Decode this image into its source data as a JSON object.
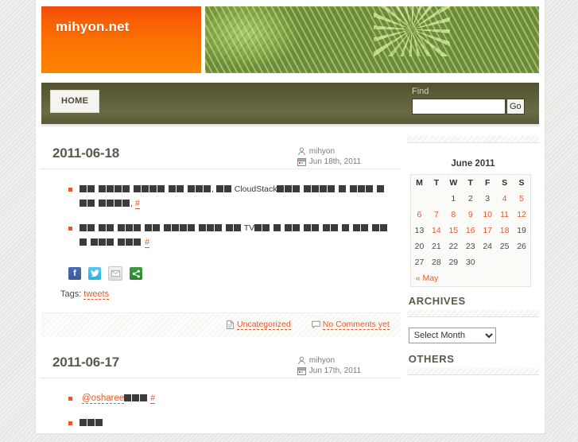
{
  "site": {
    "logo_title": "mihyon.net"
  },
  "nav": {
    "home_label": "HOME",
    "find_label": "Find",
    "find_value": "",
    "find_placeholder": "",
    "go_label": "Go"
  },
  "posts": [
    {
      "title": "2011-06-18",
      "author": "mihyon",
      "date": "Jun 18th, 2011",
      "lines": [
        {
          "runs": [
            {
              "t": "blocks",
              "n": 2
            },
            {
              "t": "sp"
            },
            {
              "t": "blocks",
              "n": 4
            },
            {
              "t": "sp"
            },
            {
              "t": "blocks",
              "n": 4
            },
            {
              "t": "sp"
            },
            {
              "t": "blocks",
              "n": 2
            },
            {
              "t": "sp"
            },
            {
              "t": "blocks",
              "n": 3
            },
            {
              "t": "text",
              "v": ", "
            },
            {
              "t": "blocks",
              "n": 2
            },
            {
              "t": "text",
              "v": " CloudStack"
            },
            {
              "t": "blocks",
              "n": 3
            },
            {
              "t": "sp"
            },
            {
              "t": "blocks",
              "n": 4
            },
            {
              "t": "sp"
            },
            {
              "t": "blocks",
              "n": 1
            },
            {
              "t": "sp"
            },
            {
              "t": "blocks",
              "n": 3
            },
            {
              "t": "sp"
            },
            {
              "t": "blocks",
              "n": 3
            },
            {
              "t": "sp"
            },
            {
              "t": "blocks",
              "n": 4
            },
            {
              "t": "text",
              "v": ", "
            },
            {
              "t": "hash",
              "v": "#"
            }
          ]
        },
        {
          "runs": [
            {
              "t": "blocks",
              "n": 2
            },
            {
              "t": "sp"
            },
            {
              "t": "blocks",
              "n": 2
            },
            {
              "t": "sp"
            },
            {
              "t": "blocks",
              "n": 3
            },
            {
              "t": "sp"
            },
            {
              "t": "blocks",
              "n": 2
            },
            {
              "t": "sp"
            },
            {
              "t": "blocks",
              "n": 4
            },
            {
              "t": "sp"
            },
            {
              "t": "blocks",
              "n": 3
            },
            {
              "t": "sp"
            },
            {
              "t": "blocks",
              "n": 2
            },
            {
              "t": "text",
              "v": " TV"
            },
            {
              "t": "blocks",
              "n": 2
            },
            {
              "t": "sp"
            },
            {
              "t": "blocks",
              "n": 1
            },
            {
              "t": "sp"
            },
            {
              "t": "blocks",
              "n": 2
            },
            {
              "t": "sp"
            },
            {
              "t": "blocks",
              "n": 2
            },
            {
              "t": "sp"
            },
            {
              "t": "blocks",
              "n": 2
            },
            {
              "t": "sp"
            },
            {
              "t": "blocks",
              "n": 1
            },
            {
              "t": "sp"
            },
            {
              "t": "blocks",
              "n": 2
            },
            {
              "t": "sp"
            },
            {
              "t": "blocks",
              "n": 3
            },
            {
              "t": "sp"
            },
            {
              "t": "blocks",
              "n": 3
            },
            {
              "t": "sp"
            },
            {
              "t": "blocks",
              "n": 3
            },
            {
              "t": "sp"
            },
            {
              "t": "hash",
              "v": "#"
            }
          ]
        }
      ],
      "share": [
        {
          "name": "facebook-share-icon",
          "glyph": "f"
        },
        {
          "name": "twitter-share-icon",
          "glyph": "ᴠ"
        },
        {
          "name": "email-share-icon",
          "glyph": "✉"
        },
        {
          "name": "share-icon",
          "glyph": "⌘"
        }
      ],
      "tags_label": "Tags:",
      "tags": [
        "tweets"
      ],
      "category": "Uncategorized",
      "comments": "No Comments yet"
    },
    {
      "title": "2011-06-17",
      "author": "mihyon",
      "date": "Jun 17th, 2011",
      "lines": [
        {
          "runs": [
            {
              "t": "mention",
              "v": "@osharee"
            },
            {
              "t": "blocks",
              "n": 3
            },
            {
              "t": "text",
              "v": " "
            },
            {
              "t": "hash",
              "v": "#"
            }
          ]
        }
      ]
    }
  ],
  "sidebar": {
    "calendar": {
      "caption": "June 2011",
      "weekdays": [
        "M",
        "T",
        "W",
        "T",
        "F",
        "S",
        "S"
      ],
      "weeks": [
        [
          {
            "d": "",
            "on": false
          },
          {
            "d": "",
            "on": false
          },
          {
            "d": "1",
            "on": false
          },
          {
            "d": "2",
            "on": false
          },
          {
            "d": "3",
            "on": false
          },
          {
            "d": "4",
            "on": true
          },
          {
            "d": "5",
            "on": true
          }
        ],
        [
          {
            "d": "6",
            "on": true
          },
          {
            "d": "7",
            "on": true
          },
          {
            "d": "8",
            "on": true
          },
          {
            "d": "9",
            "on": true
          },
          {
            "d": "10",
            "on": true
          },
          {
            "d": "11",
            "on": true
          },
          {
            "d": "12",
            "on": true
          }
        ],
        [
          {
            "d": "13",
            "on": false
          },
          {
            "d": "14",
            "on": true
          },
          {
            "d": "15",
            "on": true
          },
          {
            "d": "16",
            "on": true
          },
          {
            "d": "17",
            "on": true
          },
          {
            "d": "18",
            "on": true
          },
          {
            "d": "19",
            "on": false
          }
        ],
        [
          {
            "d": "20",
            "on": false
          },
          {
            "d": "21",
            "on": false
          },
          {
            "d": "22",
            "on": false
          },
          {
            "d": "23",
            "on": false
          },
          {
            "d": "24",
            "on": false
          },
          {
            "d": "25",
            "on": false
          },
          {
            "d": "26",
            "on": false
          }
        ],
        [
          {
            "d": "27",
            "on": false
          },
          {
            "d": "28",
            "on": false
          },
          {
            "d": "29",
            "on": false
          },
          {
            "d": "30",
            "on": false
          },
          {
            "d": "",
            "on": false
          },
          {
            "d": "",
            "on": false
          },
          {
            "d": "",
            "on": false
          }
        ]
      ],
      "prev_label": "« May"
    },
    "archives": {
      "title": "ARCHIVES",
      "select_value": "Select Month"
    },
    "others": {
      "title": "OTHERS"
    }
  },
  "colors": {
    "accent_orange": "#e8582a",
    "logo_orange": "#fb7302",
    "nav_olive": "#5d5d39",
    "title_gray": "#585b4a"
  }
}
